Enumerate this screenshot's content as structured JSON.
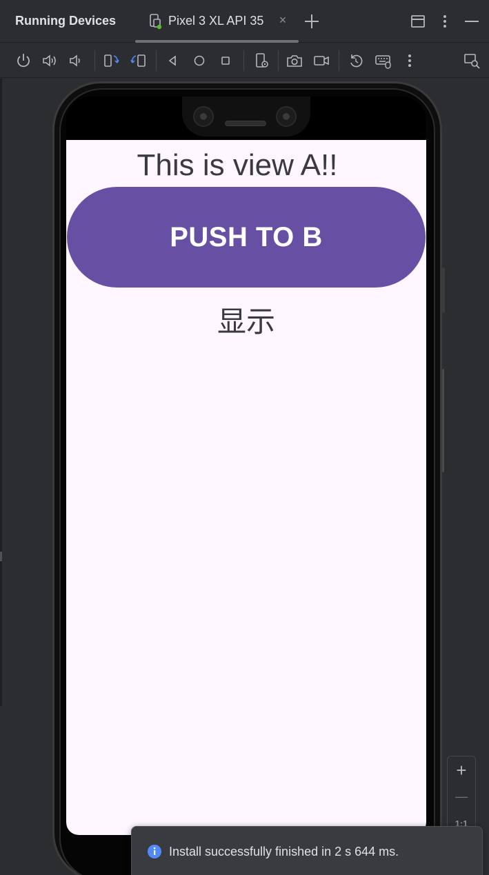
{
  "header": {
    "panel_title": "Running Devices",
    "tab_label": "Pixel 3 XL API 35",
    "tab_close": "×"
  },
  "app_screen": {
    "view_title": "This is view A!!",
    "push_button_label": "PUSH TO B",
    "result_text": "显示"
  },
  "zoom": {
    "zoom_in": "+",
    "zoom_out": "—",
    "actual_size": "1:1"
  },
  "notification": {
    "message": "Install successfully finished in 2 s 644 ms."
  },
  "colors": {
    "accent": "#6750a4",
    "app_background": "#fef7ff",
    "ide_background": "#2b2d30",
    "info": "#548af7",
    "status_green": "#5fb832"
  }
}
